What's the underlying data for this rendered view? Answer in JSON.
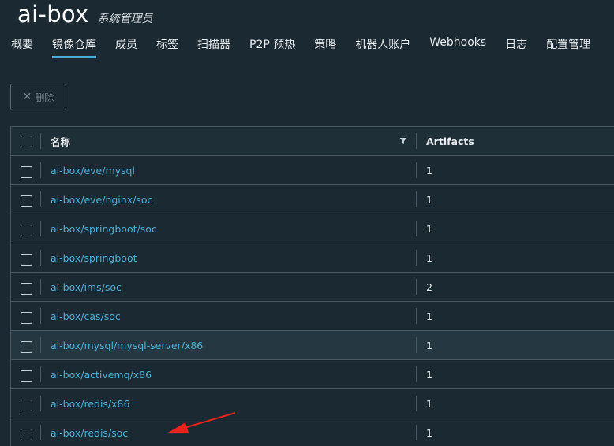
{
  "header": {
    "project_name": "ai-box",
    "role": "系统管理员"
  },
  "tabs": [
    {
      "label": "概要"
    },
    {
      "label": "镜像仓库"
    },
    {
      "label": "成员"
    },
    {
      "label": "标签"
    },
    {
      "label": "扫描器"
    },
    {
      "label": "P2P 预热"
    },
    {
      "label": "策略"
    },
    {
      "label": "机器人账户"
    },
    {
      "label": "Webhooks"
    },
    {
      "label": "日志"
    },
    {
      "label": "配置管理"
    }
  ],
  "active_tab": "镜像仓库",
  "toolbar": {
    "delete_label": "删除",
    "delete_icon": "close-icon"
  },
  "table": {
    "columns": {
      "name": "名称",
      "artifacts": "Artifacts"
    },
    "rows": [
      {
        "name": "ai-box/eve/mysql",
        "artifacts": "1"
      },
      {
        "name": "ai-box/eve/nginx/soc",
        "artifacts": "1"
      },
      {
        "name": "ai-box/springboot/soc",
        "artifacts": "1"
      },
      {
        "name": "ai-box/springboot",
        "artifacts": "1"
      },
      {
        "name": "ai-box/ims/soc",
        "artifacts": "2"
      },
      {
        "name": "ai-box/cas/soc",
        "artifacts": "1"
      },
      {
        "name": "ai-box/mysql/mysql-server/x86",
        "artifacts": "1"
      },
      {
        "name": "ai-box/activemq/x86",
        "artifacts": "1"
      },
      {
        "name": "ai-box/redis/x86",
        "artifacts": "1"
      },
      {
        "name": "ai-box/redis/soc",
        "artifacts": "1"
      }
    ]
  },
  "annotation": {
    "arrow_color": "#e8231b"
  },
  "colors": {
    "background": "#1b2a32",
    "link": "#49afd9",
    "tab_active_underline": "#49afd9"
  }
}
